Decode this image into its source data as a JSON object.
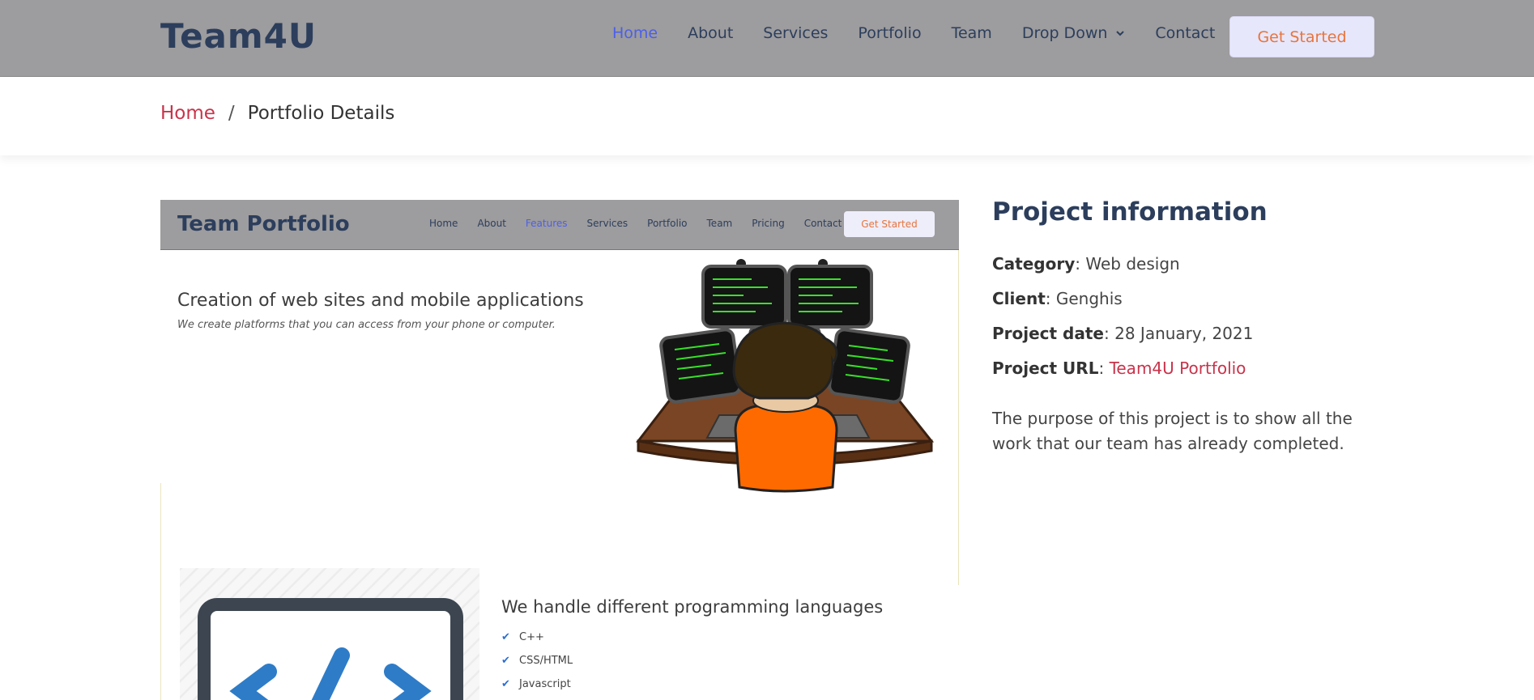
{
  "header": {
    "logo": "Team4U",
    "nav": [
      "Home",
      "About",
      "Services",
      "Portfolio",
      "Team",
      "Drop Down",
      "Contact"
    ],
    "active_nav": "Home",
    "cta": "Get Started"
  },
  "breadcrumb": {
    "home": "Home",
    "sep": "/",
    "current": "Portfolio Details"
  },
  "portfolio_image": {
    "logo": "Team Portfolio",
    "nav": [
      "Home",
      "About",
      "Features",
      "Services",
      "Portfolio",
      "Team",
      "Pricing",
      "Contact"
    ],
    "active_nav": "Features",
    "cta": "Get Started",
    "hero_title": "Creation of web sites and mobile applications",
    "hero_subtitle": "We create platforms that you can access from your phone or computer.",
    "languages_title": "We handle different programming languages",
    "languages": [
      "C++",
      "CSS/HTML",
      "Javascript"
    ]
  },
  "project_info": {
    "title": "Project information",
    "category_label": "Category",
    "category": "Web design",
    "client_label": "Client",
    "client": "Genghis",
    "date_label": "Project date",
    "date": "28 January, 2021",
    "url_label": "Project URL",
    "url_text": "Team4U Portfolio",
    "description": "The purpose of this project is to show all the work that our team has already completed."
  },
  "colors": {
    "header_bg": "#9d9c9e",
    "brand_dark": "#2c3e5c",
    "accent_blue": "#4c5fe8",
    "link_red": "#c9334b",
    "cta_text": "#e8743c"
  }
}
